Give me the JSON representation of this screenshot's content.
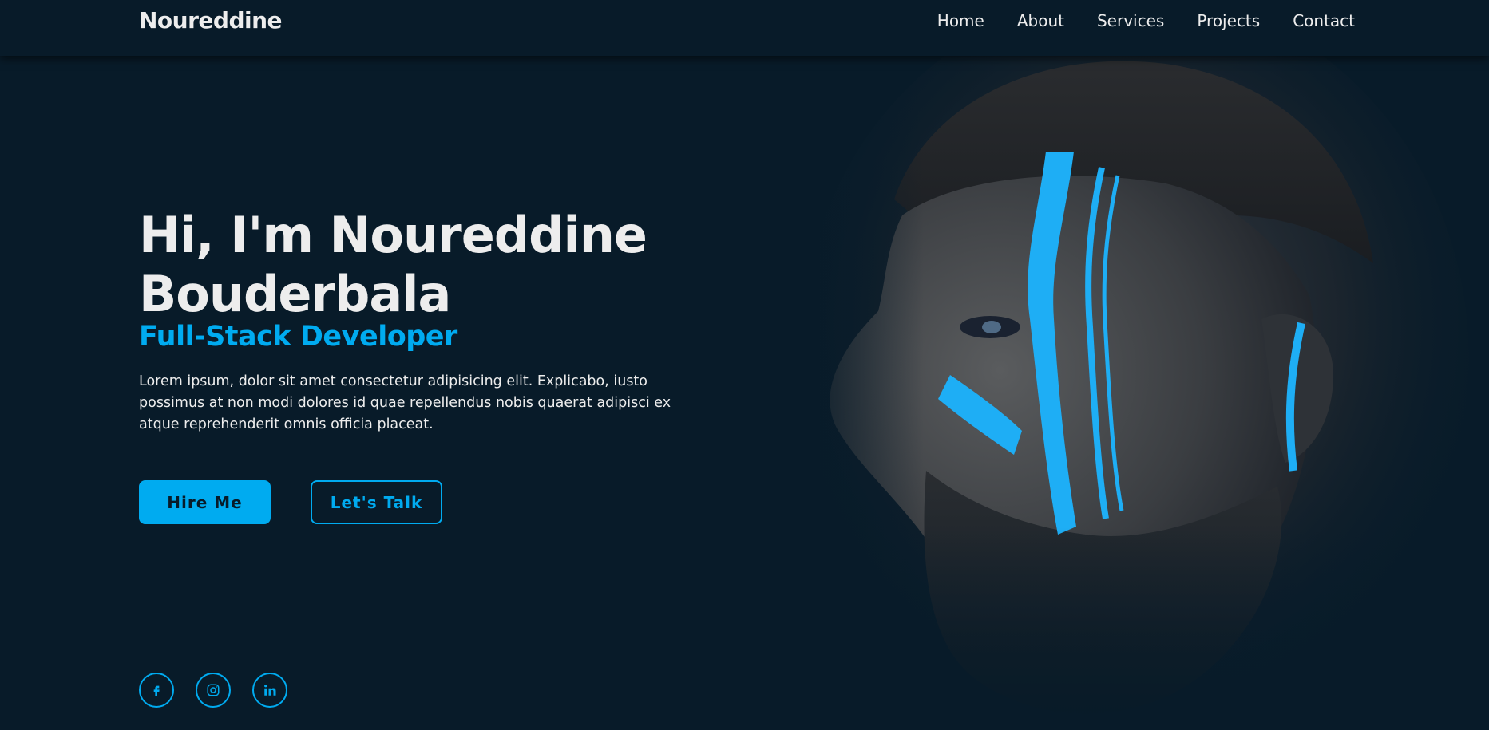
{
  "header": {
    "logo": "Noureddine",
    "nav": [
      "Home",
      "About",
      "Services",
      "Projects",
      "Contact"
    ]
  },
  "hero": {
    "title_line1": "Hi, I'm Noureddine",
    "title_line2": "Bouderbala",
    "subtitle": "Full-Stack Developer",
    "description": "Lorem ipsum, dolor sit amet consectetur adipisicing elit. Explicabo, iusto possimus at non modi dolores id quae repellendus nobis quaerat adipisci ex atque reprehenderit omnis officia placeat.",
    "buttons": {
      "hire": "Hire Me",
      "talk": "Let's Talk"
    },
    "image_icon": "man-portrait-with-blue-face-paint"
  },
  "socials": [
    {
      "icon": "facebook-icon"
    },
    {
      "icon": "instagram-icon"
    },
    {
      "icon": "linkedin-icon"
    }
  ],
  "colors": {
    "background": "#081b29",
    "accent": "#00abf0",
    "text": "#ededed"
  }
}
